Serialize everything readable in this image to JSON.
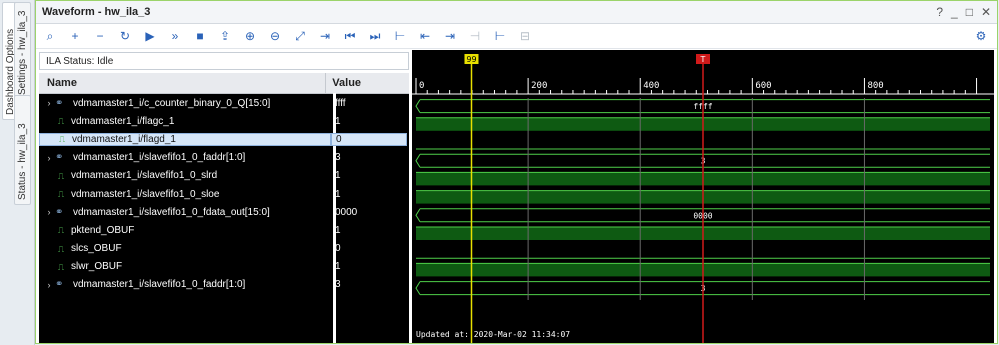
{
  "side_tabs": [
    "Dashboard Options",
    "Settings - hw_ila_3",
    "Status - hw_ila_3"
  ],
  "window": {
    "title": "Waveform - hw_ila_3",
    "controls": [
      "?",
      "_",
      "□",
      "✕"
    ]
  },
  "toolbar": {
    "buttons": [
      {
        "name": "search-icon",
        "glyph": "⌕",
        "enabled": true
      },
      {
        "name": "add-icon",
        "glyph": "+",
        "enabled": true
      },
      {
        "name": "remove-icon",
        "glyph": "−",
        "enabled": true
      },
      {
        "name": "run-trigger-immediate-icon",
        "glyph": "↻",
        "enabled": true
      },
      {
        "name": "run-trigger-icon",
        "glyph": "▶",
        "enabled": true
      },
      {
        "name": "auto-retrigger-icon",
        "glyph": "»",
        "enabled": true
      },
      {
        "name": "stop-icon",
        "glyph": "■",
        "enabled": true
      },
      {
        "name": "export-icon",
        "glyph": "⇪",
        "enabled": true
      },
      {
        "name": "zoom-in-icon",
        "glyph": "⊕",
        "enabled": true
      },
      {
        "name": "zoom-out-icon",
        "glyph": "⊖",
        "enabled": true
      },
      {
        "name": "zoom-fit-icon",
        "glyph": "⤢",
        "enabled": true
      },
      {
        "name": "go-to-cursor-icon",
        "glyph": "⇥",
        "enabled": true
      },
      {
        "name": "go-to-start-icon",
        "glyph": "⏮",
        "enabled": true
      },
      {
        "name": "go-to-end-icon",
        "glyph": "⏭",
        "enabled": true
      },
      {
        "name": "add-marker-icon",
        "glyph": "⊢",
        "enabled": true
      },
      {
        "name": "previous-transition-icon",
        "glyph": "⇤",
        "enabled": true
      },
      {
        "name": "next-transition-icon",
        "glyph": "⇥",
        "enabled": true
      },
      {
        "name": "previous-marker-icon",
        "glyph": "⊣",
        "enabled": false
      },
      {
        "name": "next-marker-icon",
        "glyph": "⊢",
        "enabled": true
      },
      {
        "name": "swap-markers-icon",
        "glyph": "⊟",
        "enabled": false
      }
    ]
  },
  "ila_status": "ILA Status: Idle",
  "columns": {
    "name": "Name",
    "value": "Value"
  },
  "signals": [
    {
      "name": "vdmamaster1_i/c_counter_binary_0_Q[15:0]",
      "value": "ffff",
      "bus": true,
      "wave_label": "ffff",
      "level": null
    },
    {
      "name": "vdmamaster1_i/flagc_1",
      "value": "1",
      "bus": false,
      "wave_label": "",
      "level": 1
    },
    {
      "name": "vdmamaster1_i/flagd_1",
      "value": "0",
      "bus": false,
      "wave_label": "",
      "level": 0,
      "selected": true
    },
    {
      "name": "vdmamaster1_i/slavefifo1_0_faddr[1:0]",
      "value": "3",
      "bus": true,
      "wave_label": "3",
      "level": null
    },
    {
      "name": "vdmamaster1_i/slavefifo1_0_slrd",
      "value": "1",
      "bus": false,
      "wave_label": "",
      "level": 1
    },
    {
      "name": "vdmamaster1_i/slavefifo1_0_sloe",
      "value": "1",
      "bus": false,
      "wave_label": "",
      "level": 1
    },
    {
      "name": "vdmamaster1_i/slavefifo1_0_fdata_out[15:0]",
      "value": "0000",
      "bus": true,
      "wave_label": "0000",
      "level": null
    },
    {
      "name": "pktend_OBUF",
      "value": "1",
      "bus": false,
      "wave_label": "",
      "level": 1
    },
    {
      "name": "slcs_OBUF",
      "value": "0",
      "bus": false,
      "wave_label": "",
      "level": 0
    },
    {
      "name": "slwr_OBUF",
      "value": "1",
      "bus": false,
      "wave_label": "",
      "level": 1
    },
    {
      "name": "vdmamaster1_i/slavefifo1_0_faddr[1:0]",
      "value": "3",
      "bus": true,
      "wave_label": "3",
      "level": null
    }
  ],
  "timeline": {
    "ticks": [
      "0",
      "200",
      "400",
      "600",
      "800"
    ],
    "tick_values": [
      0,
      200,
      400,
      600,
      800
    ],
    "range": [
      0,
      1024
    ],
    "markers": [
      {
        "label": "99",
        "value": 99,
        "color": "#e8e000"
      },
      {
        "label": "T",
        "value": 512,
        "color": "#d11a1a"
      }
    ]
  },
  "updated_text": "Updated at: 2020-Mar-02 11:34:07",
  "colors": {
    "wave_bg": "#000000",
    "wave_green": "#4fd04a",
    "wave_fill": "#0e5a12",
    "panel_border": "#9bd36a"
  }
}
